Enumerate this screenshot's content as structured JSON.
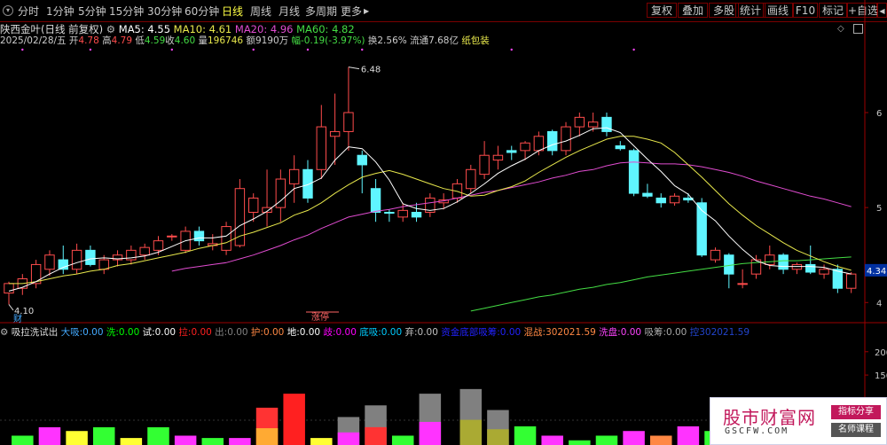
{
  "toolbar": {
    "periods": [
      "分时",
      "1分钟",
      "5分钟",
      "15分钟",
      "30分钟",
      "60分钟",
      "日线",
      "周线",
      "月线",
      "多周期",
      "更多"
    ],
    "active_period": "日线",
    "more_arrow": "▶",
    "right_buttons": [
      "复权",
      "叠加",
      "多股",
      "统计",
      "画线",
      "F10",
      "标记",
      "+自选",
      "◀"
    ]
  },
  "header": {
    "stock_name": "陕西金叶(日线 前复权)",
    "ma5_label": "MA5:",
    "ma5": "4.55",
    "ma10_label": "MA10:",
    "ma10": "4.61",
    "ma20_label": "MA20:",
    "ma20": "4.96",
    "ma60_label": "MA60:",
    "ma60": "4.82",
    "date": "2025/02/28/五",
    "open_label": "开",
    "open": "4.78",
    "high_label": "高",
    "high": "4.79",
    "low_label": "低",
    "low": "4.59",
    "close_label": "收",
    "close": "4.60",
    "vol_label": "量",
    "vol": "196746",
    "amount_label": "额",
    "amount": "9190万",
    "change_label": "幅",
    "change": "-0.19(-3.97%)",
    "turnover_label": "换",
    "turnover": "2.56%",
    "float_label": "流通",
    "float": "7.68亿",
    "concept": "纸包装"
  },
  "chart_labels": {
    "high_price": "6.48",
    "low_price": "4.10",
    "current_price": "4.34",
    "cai_marker": "财",
    "zhangting_marker": "涨停"
  },
  "y_axis": {
    "ticks": [
      "6",
      "5",
      "4"
    ]
  },
  "indicator": {
    "name": "吸拉洗试出",
    "items": [
      {
        "label": "大吸:",
        "value": "0.00",
        "color": "#44aaff"
      },
      {
        "label": "洗:",
        "value": "0.00",
        "color": "#00ff00"
      },
      {
        "label": "试:",
        "value": "0.00",
        "color": "#ffffff"
      },
      {
        "label": "拉:",
        "value": "0.00",
        "color": "#ff2020"
      },
      {
        "label": "出:",
        "value": "0.00",
        "color": "#808080"
      },
      {
        "label": "护:",
        "value": "0.00",
        "color": "#ff8844"
      },
      {
        "label": "地:",
        "value": "0.00",
        "color": "#ffffff"
      },
      {
        "label": "歧:",
        "value": "0.00",
        "color": "#ff00ff"
      },
      {
        "label": "底吸:",
        "value": "0.00",
        "color": "#00ccff"
      },
      {
        "label": "弃:",
        "value": "0.00",
        "color": "#c0c0c0"
      },
      {
        "label": "资金底部吸筹:",
        "value": "0.00",
        "color": "#2222ff"
      },
      {
        "label": "混战:",
        "value": "302021.59",
        "color": "#ff8844"
      },
      {
        "label": "洗盘:",
        "value": "0.00",
        "color": "#ff44ff"
      },
      {
        "label": "吸筹:",
        "value": "0.00",
        "color": "#aaaaaa"
      },
      {
        "label": "控",
        "value": "302021.59",
        "color": "#2244cc"
      }
    ],
    "y_ticks": [
      "200",
      "150"
    ]
  },
  "watermark": {
    "name": "股市财富网",
    "url": "GSCFW.COM",
    "tag1": "指标分享",
    "tag2": "名师课程"
  },
  "colors": {
    "up": "#ff4c4c",
    "down": "#5ff5ff",
    "ma5": "#ffffff",
    "ma10": "#e8e84c",
    "ma20": "#e04cd0",
    "ma60": "#44dd44",
    "axis": "#9c0000"
  },
  "chart_data": {
    "type": "candlestick",
    "price_ylim": [
      3.9,
      6.7
    ],
    "candles": [
      {
        "o": 4.1,
        "h": 4.22,
        "l": 3.98,
        "c": 4.2
      },
      {
        "o": 4.15,
        "h": 4.3,
        "l": 4.08,
        "c": 4.25
      },
      {
        "o": 4.2,
        "h": 4.45,
        "l": 4.15,
        "c": 4.4
      },
      {
        "o": 4.35,
        "h": 4.55,
        "l": 4.28,
        "c": 4.5
      },
      {
        "o": 4.45,
        "h": 4.6,
        "l": 4.3,
        "c": 4.35
      },
      {
        "o": 4.35,
        "h": 4.62,
        "l": 4.3,
        "c": 4.55
      },
      {
        "o": 4.55,
        "h": 4.6,
        "l": 4.38,
        "c": 4.4
      },
      {
        "o": 4.35,
        "h": 4.5,
        "l": 4.3,
        "c": 4.45
      },
      {
        "o": 4.45,
        "h": 4.55,
        "l": 4.38,
        "c": 4.5
      },
      {
        "o": 4.45,
        "h": 4.6,
        "l": 4.4,
        "c": 4.55
      },
      {
        "o": 4.5,
        "h": 4.62,
        "l": 4.45,
        "c": 4.58
      },
      {
        "o": 4.55,
        "h": 4.7,
        "l": 4.5,
        "c": 4.65
      },
      {
        "o": 4.7,
        "h": 4.72,
        "l": 4.65,
        "c": 4.7
      },
      {
        "o": 4.55,
        "h": 4.8,
        "l": 4.52,
        "c": 4.75
      },
      {
        "o": 4.75,
        "h": 4.8,
        "l": 4.6,
        "c": 4.65
      },
      {
        "o": 4.6,
        "h": 4.72,
        "l": 4.55,
        "c": 4.62
      },
      {
        "o": 4.55,
        "h": 4.85,
        "l": 4.5,
        "c": 4.8
      },
      {
        "o": 4.6,
        "h": 5.3,
        "l": 4.58,
        "c": 5.2
      },
      {
        "o": 4.95,
        "h": 5.15,
        "l": 4.85,
        "c": 5.1
      },
      {
        "o": 4.95,
        "h": 5.4,
        "l": 4.8,
        "c": 5.0
      },
      {
        "o": 5.0,
        "h": 5.4,
        "l": 4.85,
        "c": 5.3
      },
      {
        "o": 5.25,
        "h": 5.55,
        "l": 5.05,
        "c": 5.4
      },
      {
        "o": 5.4,
        "h": 5.5,
        "l": 5.05,
        "c": 5.1
      },
      {
        "o": 5.4,
        "h": 6.08,
        "l": 5.3,
        "c": 5.85
      },
      {
        "o": 5.75,
        "h": 6.2,
        "l": 5.45,
        "c": 5.8
      },
      {
        "o": 5.8,
        "h": 6.48,
        "l": 5.6,
        "c": 6.0
      },
      {
        "o": 5.55,
        "h": 5.6,
        "l": 5.15,
        "c": 5.45
      },
      {
        "o": 5.2,
        "h": 5.3,
        "l": 4.85,
        "c": 4.95
      },
      {
        "o": 4.95,
        "h": 4.98,
        "l": 4.85,
        "c": 4.94
      },
      {
        "o": 4.9,
        "h": 5.05,
        "l": 4.85,
        "c": 4.97
      },
      {
        "o": 4.95,
        "h": 5.05,
        "l": 4.85,
        "c": 4.9
      },
      {
        "o": 4.95,
        "h": 5.15,
        "l": 4.9,
        "c": 5.1
      },
      {
        "o": 5.05,
        "h": 5.15,
        "l": 4.98,
        "c": 5.08
      },
      {
        "o": 5.1,
        "h": 5.3,
        "l": 5.05,
        "c": 5.25
      },
      {
        "o": 5.2,
        "h": 5.45,
        "l": 5.15,
        "c": 5.4
      },
      {
        "o": 5.35,
        "h": 5.7,
        "l": 5.3,
        "c": 5.55
      },
      {
        "o": 5.5,
        "h": 5.65,
        "l": 5.4,
        "c": 5.55
      },
      {
        "o": 5.6,
        "h": 5.65,
        "l": 5.5,
        "c": 5.58
      },
      {
        "o": 5.6,
        "h": 5.7,
        "l": 5.5,
        "c": 5.68
      },
      {
        "o": 5.6,
        "h": 5.8,
        "l": 5.55,
        "c": 5.75
      },
      {
        "o": 5.8,
        "h": 5.82,
        "l": 5.55,
        "c": 5.6
      },
      {
        "o": 5.6,
        "h": 5.9,
        "l": 5.55,
        "c": 5.85
      },
      {
        "o": 5.85,
        "h": 6.0,
        "l": 5.75,
        "c": 5.95
      },
      {
        "o": 5.85,
        "h": 6.0,
        "l": 5.8,
        "c": 5.9
      },
      {
        "o": 5.95,
        "h": 6.0,
        "l": 5.75,
        "c": 5.8
      },
      {
        "o": 5.65,
        "h": 5.7,
        "l": 5.6,
        "c": 5.62
      },
      {
        "o": 5.6,
        "h": 5.62,
        "l": 5.12,
        "c": 5.15
      },
      {
        "o": 5.15,
        "h": 5.25,
        "l": 5.1,
        "c": 5.12
      },
      {
        "o": 5.1,
        "h": 5.15,
        "l": 5.0,
        "c": 5.05
      },
      {
        "o": 5.05,
        "h": 5.15,
        "l": 5.02,
        "c": 5.12
      },
      {
        "o": 5.1,
        "h": 5.15,
        "l": 5.05,
        "c": 5.08
      },
      {
        "o": 5.05,
        "h": 5.1,
        "l": 4.48,
        "c": 4.5
      },
      {
        "o": 4.45,
        "h": 4.58,
        "l": 4.42,
        "c": 4.55
      },
      {
        "o": 4.5,
        "h": 4.52,
        "l": 4.15,
        "c": 4.3
      },
      {
        "o": 4.2,
        "h": 4.35,
        "l": 4.15,
        "c": 4.2
      },
      {
        "o": 4.3,
        "h": 4.5,
        "l": 4.25,
        "c": 4.45
      },
      {
        "o": 4.4,
        "h": 4.6,
        "l": 4.35,
        "c": 4.5
      },
      {
        "o": 4.5,
        "h": 4.52,
        "l": 4.3,
        "c": 4.35
      },
      {
        "o": 4.35,
        "h": 4.42,
        "l": 4.3,
        "c": 4.4
      },
      {
        "o": 4.4,
        "h": 4.6,
        "l": 4.3,
        "c": 4.32
      },
      {
        "o": 4.3,
        "h": 4.4,
        "l": 4.25,
        "c": 4.35
      },
      {
        "o": 4.35,
        "h": 4.4,
        "l": 4.1,
        "c": 4.15
      },
      {
        "o": 4.15,
        "h": 4.32,
        "l": 4.1,
        "c": 4.3
      }
    ],
    "ma5": [
      4.12,
      4.16,
      4.22,
      4.3,
      4.37,
      4.42,
      4.46,
      4.47,
      4.46,
      4.47,
      4.49,
      4.53,
      4.59,
      4.65,
      4.68,
      4.68,
      4.7,
      4.81,
      4.88,
      4.96,
      5.07,
      5.2,
      5.24,
      5.31,
      5.5,
      5.64,
      5.62,
      5.48,
      5.29,
      5.04,
      4.99,
      4.97,
      4.99,
      5.06,
      5.15,
      5.25,
      5.36,
      5.44,
      5.51,
      5.6,
      5.66,
      5.7,
      5.76,
      5.83,
      5.84,
      5.79,
      5.65,
      5.51,
      5.38,
      5.23,
      5.14,
      4.97,
      4.86,
      4.7,
      4.56,
      4.44,
      4.39,
      4.38,
      4.38,
      4.38,
      4.37,
      4.33,
      4.3
    ],
    "ma10": [
      4.2,
      4.2,
      4.22,
      4.25,
      4.28,
      4.3,
      4.33,
      4.35,
      4.39,
      4.41,
      4.44,
      4.47,
      4.5,
      4.53,
      4.57,
      4.6,
      4.63,
      4.7,
      4.74,
      4.79,
      4.84,
      4.92,
      4.97,
      5.05,
      5.15,
      5.24,
      5.32,
      5.36,
      5.39,
      5.35,
      5.3,
      5.25,
      5.2,
      5.17,
      5.12,
      5.13,
      5.18,
      5.22,
      5.28,
      5.37,
      5.45,
      5.53,
      5.6,
      5.66,
      5.72,
      5.75,
      5.75,
      5.72,
      5.68,
      5.58,
      5.45,
      5.32,
      5.18,
      5.04,
      4.92,
      4.81,
      4.72,
      4.63,
      4.55,
      4.49,
      4.43,
      4.38,
      4.34
    ],
    "ma20": [
      null,
      null,
      null,
      null,
      null,
      null,
      null,
      null,
      null,
      null,
      null,
      null,
      4.33,
      4.36,
      4.38,
      4.4,
      4.42,
      4.46,
      4.5,
      4.55,
      4.6,
      4.66,
      4.71,
      4.78,
      4.84,
      4.9,
      4.93,
      4.96,
      4.98,
      5.01,
      5.03,
      5.05,
      5.07,
      5.1,
      5.13,
      5.16,
      5.18,
      5.21,
      5.24,
      5.27,
      5.31,
      5.34,
      5.38,
      5.4,
      5.44,
      5.47,
      5.48,
      5.47,
      5.46,
      5.46,
      5.45,
      5.43,
      5.4,
      5.37,
      5.33,
      5.28,
      5.24,
      5.2,
      5.16,
      5.12,
      5.09,
      5.05,
      5.01
    ],
    "ma60": [
      null,
      null,
      null,
      null,
      null,
      null,
      null,
      null,
      null,
      null,
      null,
      null,
      null,
      null,
      null,
      null,
      null,
      null,
      null,
      null,
      null,
      null,
      null,
      null,
      null,
      null,
      null,
      null,
      null,
      null,
      null,
      null,
      null,
      null,
      3.91,
      3.94,
      3.97,
      4.0,
      4.03,
      4.06,
      4.08,
      4.11,
      4.14,
      4.16,
      4.19,
      4.21,
      4.24,
      4.27,
      4.29,
      4.31,
      4.33,
      4.35,
      4.37,
      4.39,
      4.41,
      4.42,
      4.43,
      4.44,
      4.44,
      4.45,
      4.46,
      4.47,
      4.48
    ],
    "indicator_ylim": [
      0,
      230
    ],
    "indicator_bars": [
      {
        "i": 1,
        "v": 20,
        "c": "#33ff33"
      },
      {
        "i": 3,
        "v": 38,
        "c": "#ff33ff"
      },
      {
        "i": 5,
        "v": 30,
        "c": "#ffff33"
      },
      {
        "i": 7,
        "v": 38,
        "c": "#33ff33"
      },
      {
        "i": 9,
        "v": 15,
        "c": "#ffff33"
      },
      {
        "i": 11,
        "v": 38,
        "c": "#33ff33"
      },
      {
        "i": 13,
        "v": 20,
        "c": "#ff33ff"
      },
      {
        "i": 15,
        "v": 15,
        "c": "#33ff33"
      },
      {
        "i": 17,
        "v": 15,
        "c": "#ff33ff"
      },
      {
        "i": 19,
        "v": 80,
        "c": "#ff3333",
        "c2": "#ffaa33"
      },
      {
        "i": 21,
        "v": 110,
        "c": "#ff2020"
      },
      {
        "i": 23,
        "v": 15,
        "c": "#ffff33"
      },
      {
        "i": 25,
        "v": 60,
        "c": "#808080",
        "c2": "#ff33ff"
      },
      {
        "i": 27,
        "v": 85,
        "c": "#808080",
        "c2": "#ff3333"
      },
      {
        "i": 29,
        "v": 20,
        "c": "#33ff33"
      },
      {
        "i": 31,
        "v": 110,
        "c": "#808080",
        "c2": "#ff33ff"
      },
      {
        "i": 34,
        "v": 120,
        "c": "#808080",
        "c2": "#aaaa33"
      },
      {
        "i": 36,
        "v": 75,
        "c": "#808080",
        "c2": "#aaaa33"
      },
      {
        "i": 38,
        "v": 40,
        "c": "#33ff33"
      },
      {
        "i": 40,
        "v": 20,
        "c": "#ff33ff"
      },
      {
        "i": 42,
        "v": 10,
        "c": "#33ff33"
      },
      {
        "i": 44,
        "v": 20,
        "c": "#33ff33"
      },
      {
        "i": 46,
        "v": 30,
        "c": "#ff33ff"
      },
      {
        "i": 48,
        "v": 20,
        "c": "#ff8844"
      },
      {
        "i": 50,
        "v": 40,
        "c": "#ff33ff"
      },
      {
        "i": 52,
        "v": 30,
        "c": "#33ff33"
      },
      {
        "i": 54,
        "v": 20,
        "c": "#ff8844"
      },
      {
        "i": 56,
        "v": 15,
        "c": "#33ff33"
      }
    ]
  }
}
